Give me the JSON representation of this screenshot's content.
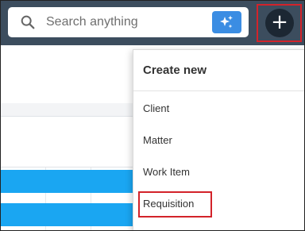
{
  "search": {
    "placeholder": "Search anything"
  },
  "icons": {
    "search": "search-icon",
    "ai": "sparkle-icon",
    "add": "plus-icon"
  },
  "colors": {
    "topbar": "#3c4d5e",
    "ai_button": "#3b8de3",
    "add_button": "#1c2733",
    "highlight": "#d3232a",
    "chart_bar": "#1aa6f2"
  },
  "create_menu": {
    "title": "Create new",
    "items": [
      {
        "label": "Client"
      },
      {
        "label": "Matter"
      },
      {
        "label": "Work Item"
      },
      {
        "label": "Requisition"
      }
    ]
  }
}
